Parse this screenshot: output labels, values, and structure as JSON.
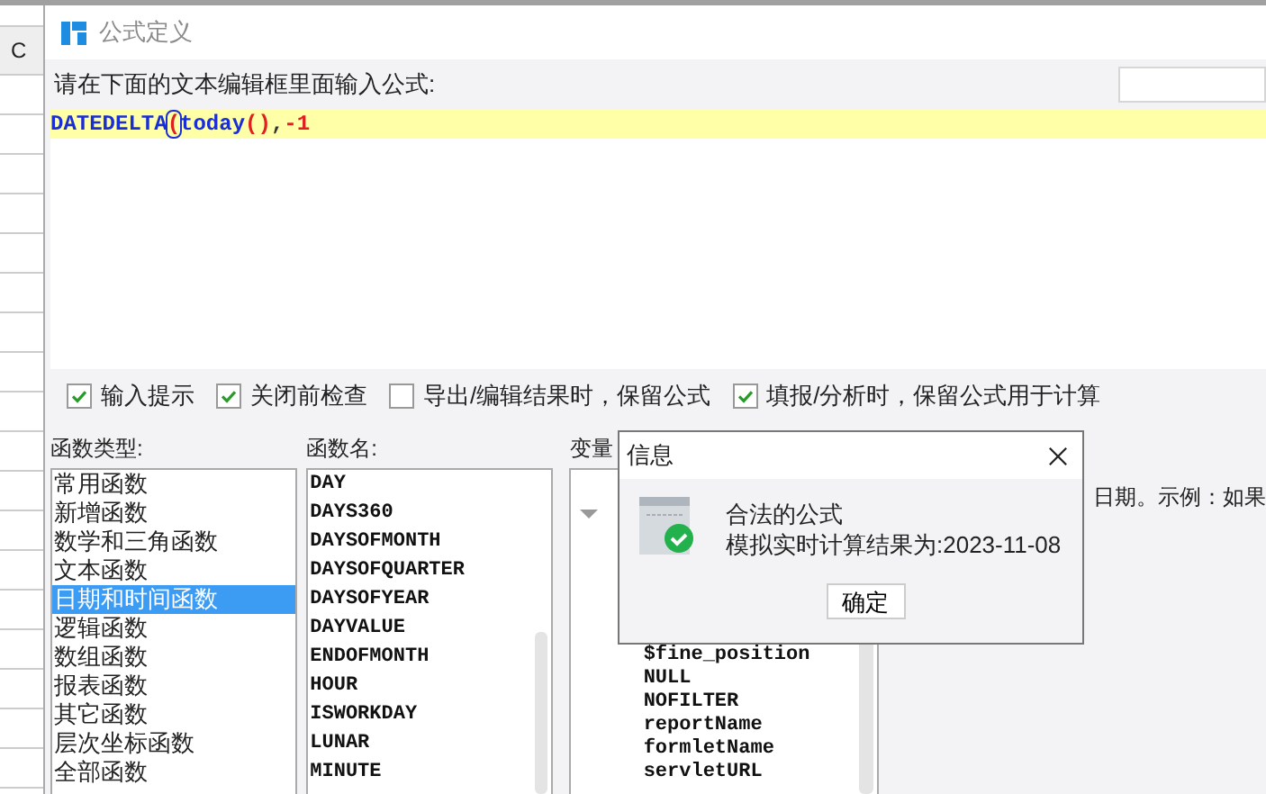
{
  "sheet": {
    "column_header": "C"
  },
  "window": {
    "title": "公式定义"
  },
  "prompt": "请在下面的文本编辑框里面输入公式:",
  "formula": [
    {
      "kind": "function",
      "text": "DATEDELTA",
      "highlighted": false
    },
    {
      "kind": "paren",
      "text": "(",
      "highlighted": true
    },
    {
      "kind": "function",
      "text": "today",
      "highlighted": false
    },
    {
      "kind": "paren",
      "text": "()",
      "highlighted": false
    },
    {
      "kind": "punct",
      "text": ",",
      "highlighted": false
    },
    {
      "kind": "number",
      "text": "-1",
      "highlighted": false
    }
  ],
  "options": [
    {
      "label": "输入提示",
      "checked": true
    },
    {
      "label": "关闭前检查",
      "checked": true
    },
    {
      "label": "导出/编辑结果时，保留公式",
      "checked": false
    },
    {
      "label": "填报/分析时，保留公式用于计算",
      "checked": true
    }
  ],
  "function_types": {
    "label": "函数类型:",
    "items": [
      {
        "label": "常用函数",
        "selected": false
      },
      {
        "label": "新增函数",
        "selected": false
      },
      {
        "label": "数学和三角函数",
        "selected": false
      },
      {
        "label": "文本函数",
        "selected": false
      },
      {
        "label": "日期和时间函数",
        "selected": true
      },
      {
        "label": "逻辑函数",
        "selected": false
      },
      {
        "label": "数组函数",
        "selected": false
      },
      {
        "label": "报表函数",
        "selected": false
      },
      {
        "label": "其它函数",
        "selected": false
      },
      {
        "label": "层次坐标函数",
        "selected": false
      },
      {
        "label": "全部函数",
        "selected": false
      }
    ]
  },
  "function_names": {
    "label": "函数名:",
    "items": [
      "DAY",
      "DAYS360",
      "DAYSOFMONTH",
      "DAYSOFQUARTER",
      "DAYSOFYEAR",
      "DAYVALUE",
      "ENDOFMONTH",
      "HOUR",
      "ISWORKDAY",
      "LUNAR",
      "MINUTE"
    ]
  },
  "variables": {
    "label": "变量",
    "items": [
      "$fine_position",
      "NULL",
      "NOFILTER",
      "reportName",
      "formletName",
      "servletURL"
    ]
  },
  "description": "日期。示例：如果",
  "message_dialog": {
    "title": "信息",
    "message": "合法的公式",
    "result": "模拟实时计算结果为:2023-11-08",
    "button": "确定"
  }
}
